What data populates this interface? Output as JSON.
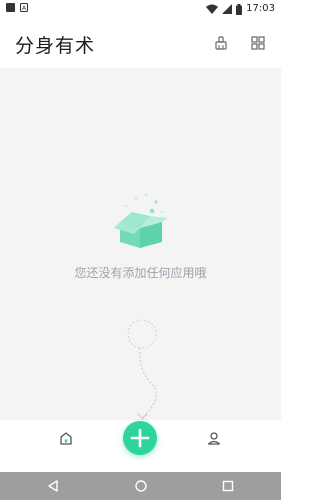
{
  "status_bar": {
    "time": "17:03",
    "icons": [
      "app-notification-icon",
      "a-notification-icon",
      "wifi-icon",
      "signal-icon",
      "battery-icon"
    ]
  },
  "header": {
    "title": "分身有术",
    "actions": [
      "cleaner-icon",
      "grid-icon"
    ]
  },
  "empty_state": {
    "message": "您还没有添加任何应用哦",
    "illustration": "open-box-icon"
  },
  "bottom_nav": {
    "items": [
      "home-icon",
      "add-icon",
      "profile-icon"
    ],
    "fab_color": "#2fd49c"
  },
  "system_nav": [
    "back-icon",
    "home-circle-icon",
    "recents-icon"
  ],
  "colors": {
    "accent": "#2fd49c",
    "background": "#f4f4f4",
    "text_muted": "#9aa3ad"
  }
}
